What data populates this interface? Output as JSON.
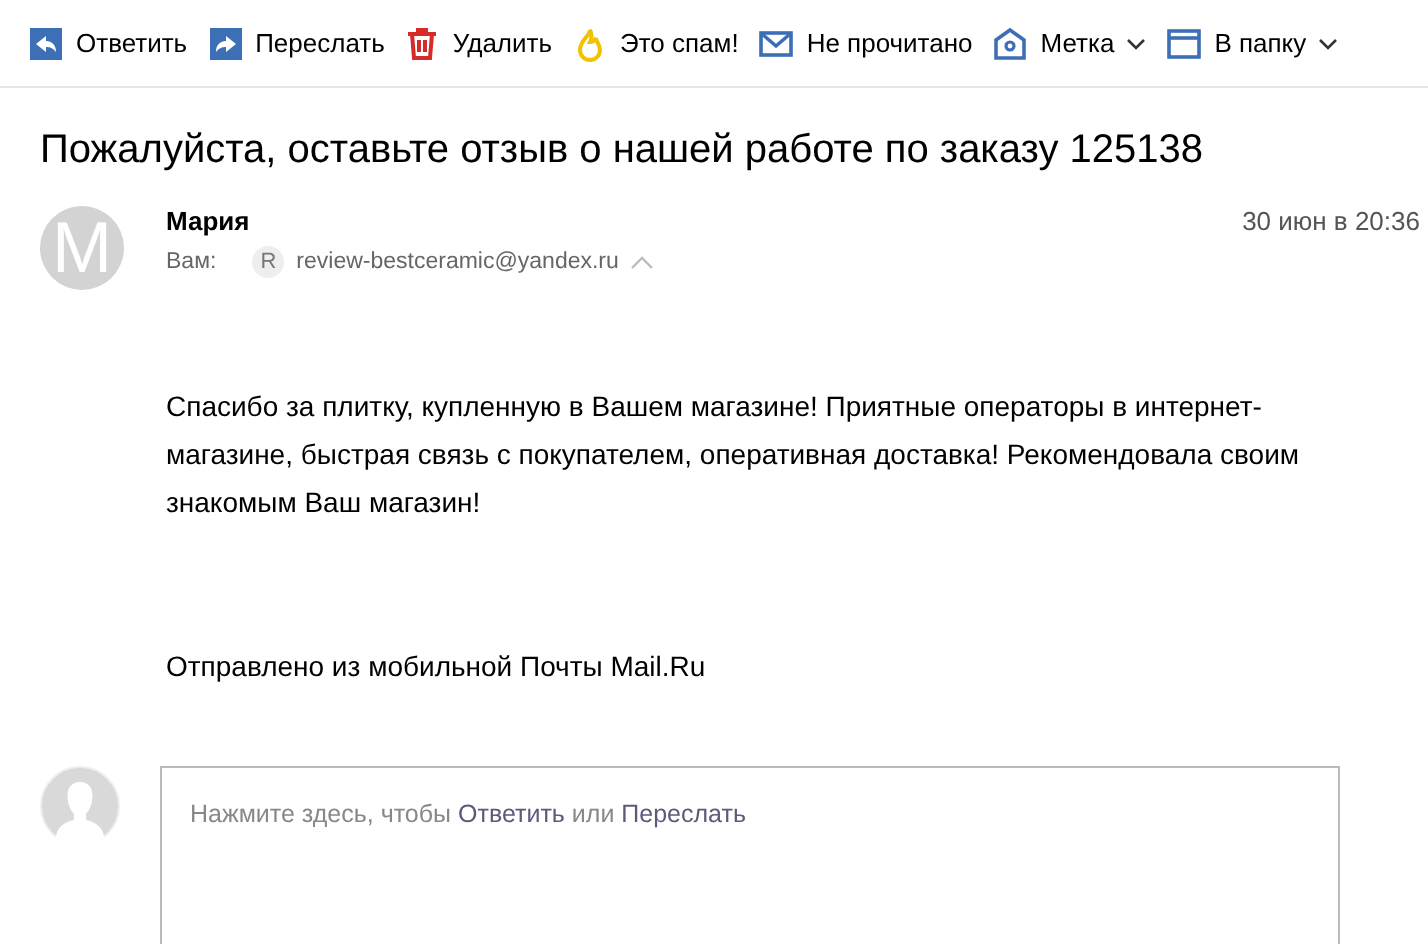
{
  "toolbar": [
    {
      "kind": "reply",
      "label": "Ответить",
      "dropdown": false
    },
    {
      "kind": "forward",
      "label": "Переслать",
      "dropdown": false
    },
    {
      "kind": "delete",
      "label": "Удалить",
      "dropdown": false
    },
    {
      "kind": "spam",
      "label": "Это спам!",
      "dropdown": false
    },
    {
      "kind": "unread",
      "label": "Не прочитано",
      "dropdown": false
    },
    {
      "kind": "label",
      "label": "Метка",
      "dropdown": true
    },
    {
      "kind": "folder",
      "label": "В папку",
      "dropdown": true
    }
  ],
  "subject": "Пожалуйста, оставьте отзыв о нашей работе по заказу 125138",
  "message": {
    "avatar_letter": "M",
    "sender": "Мария",
    "date": "30 июн в 20:36",
    "to_label": "Вам:",
    "recipient_letter": "R",
    "recipient": "review-bestceramic@yandex.ru",
    "body": "Спасибо за плитку, купленную в Вашем магазине! Приятные операторы в интернет-магазине, быстрая связь с покупателем, оперативная доставка! Рекомендовала своим знакомым Ваш магазин!",
    "signature": "Отправлено из мобильной Почты Mail.Ru"
  },
  "reply_box": {
    "prefix": "Нажмите здесь, чтобы",
    "reply_link": "Ответить",
    "middle": "или",
    "forward_link": "Переслать"
  }
}
